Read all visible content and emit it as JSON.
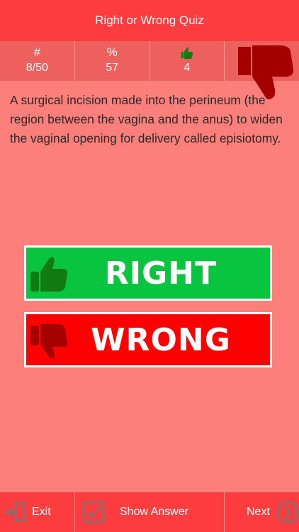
{
  "header": {
    "title": "Right or Wrong Quiz"
  },
  "stats": {
    "count": {
      "icon": "#",
      "value": "8/50"
    },
    "percent": {
      "icon": "%",
      "value": "57"
    },
    "correct": {
      "icon": "thumbs-up-icon",
      "value": "4"
    },
    "wrong": {
      "icon": "thumbs-down-icon"
    }
  },
  "question": {
    "text": "A surgical incision made into the perineum (the region between the vagina and the anus) to widen the vaginal opening for delivery called episiotomy."
  },
  "answers": {
    "right_label": "RIGHT",
    "wrong_label": "WRONG"
  },
  "bottom_bar": {
    "exit_label": "Exit",
    "show_answer_label": "Show Answer",
    "next_label": "Next"
  },
  "colors": {
    "background": "#fc7f7c",
    "title_bar": "#fc3c3f",
    "stats_bar": "#ee605d",
    "right_button": "#08c43f",
    "wrong_button": "#ff0000",
    "thumb_up": "#117a10",
    "thumb_down": "#a50000"
  }
}
